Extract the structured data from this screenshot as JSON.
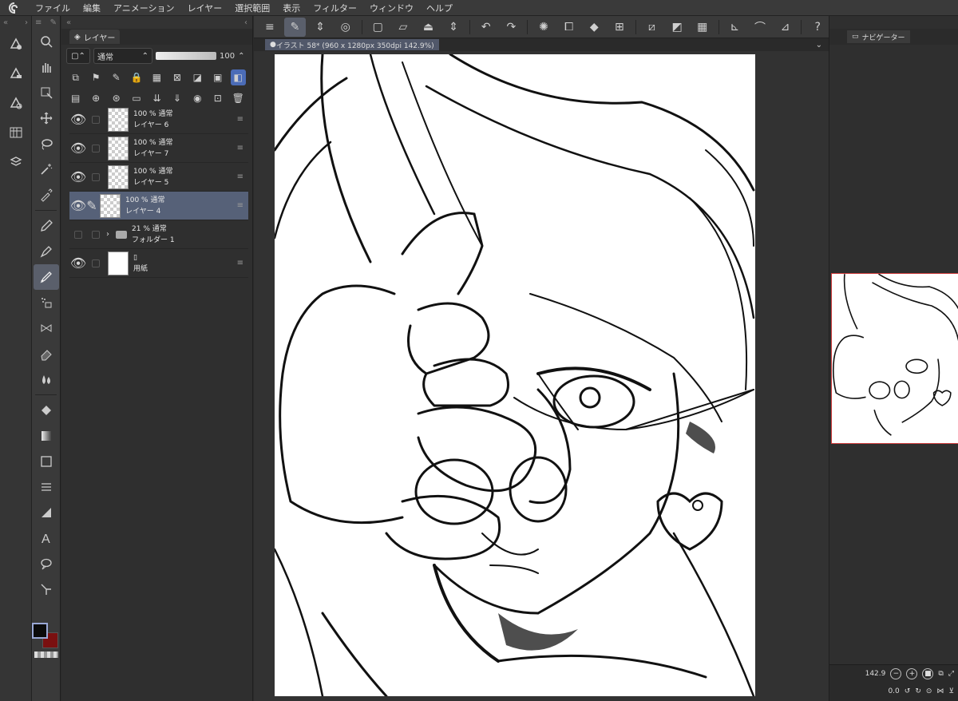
{
  "menubar": {
    "items": [
      "ファイル",
      "編集",
      "アニメーション",
      "レイヤー",
      "選択範囲",
      "表示",
      "フィルター",
      "ウィンドウ",
      "ヘルプ"
    ]
  },
  "layer_panel": {
    "tab_label": "レイヤー",
    "blend_mode": "通常",
    "opacity": "100",
    "layers": [
      {
        "opacity_mode": "100 % 通常",
        "name": "レイヤー 6",
        "thumb": "transparent",
        "selected": false
      },
      {
        "opacity_mode": "100 % 通常",
        "name": "レイヤー 7",
        "thumb": "transparent",
        "selected": false
      },
      {
        "opacity_mode": "100 % 通常",
        "name": "レイヤー 5",
        "thumb": "transparent",
        "selected": false
      },
      {
        "opacity_mode": "100 % 通常",
        "name": "レイヤー 4",
        "thumb": "sketch",
        "selected": true
      },
      {
        "opacity_mode": "21 % 通常",
        "name": "フォルダー 1",
        "thumb": "folder",
        "selected": false
      },
      {
        "opacity_mode": "",
        "name": "用紙",
        "thumb": "white",
        "selected": false
      }
    ]
  },
  "canvas": {
    "doc_tab": "イラスト 58* (960 x 1280px 350dpi 142.9%)"
  },
  "navigator": {
    "tab_label": "ナビゲーター",
    "zoom": "142.9",
    "rotation": "0.0"
  },
  "colors": {
    "main": "#0b0b0b",
    "sub": "#7a1010",
    "selection": "#566178"
  }
}
